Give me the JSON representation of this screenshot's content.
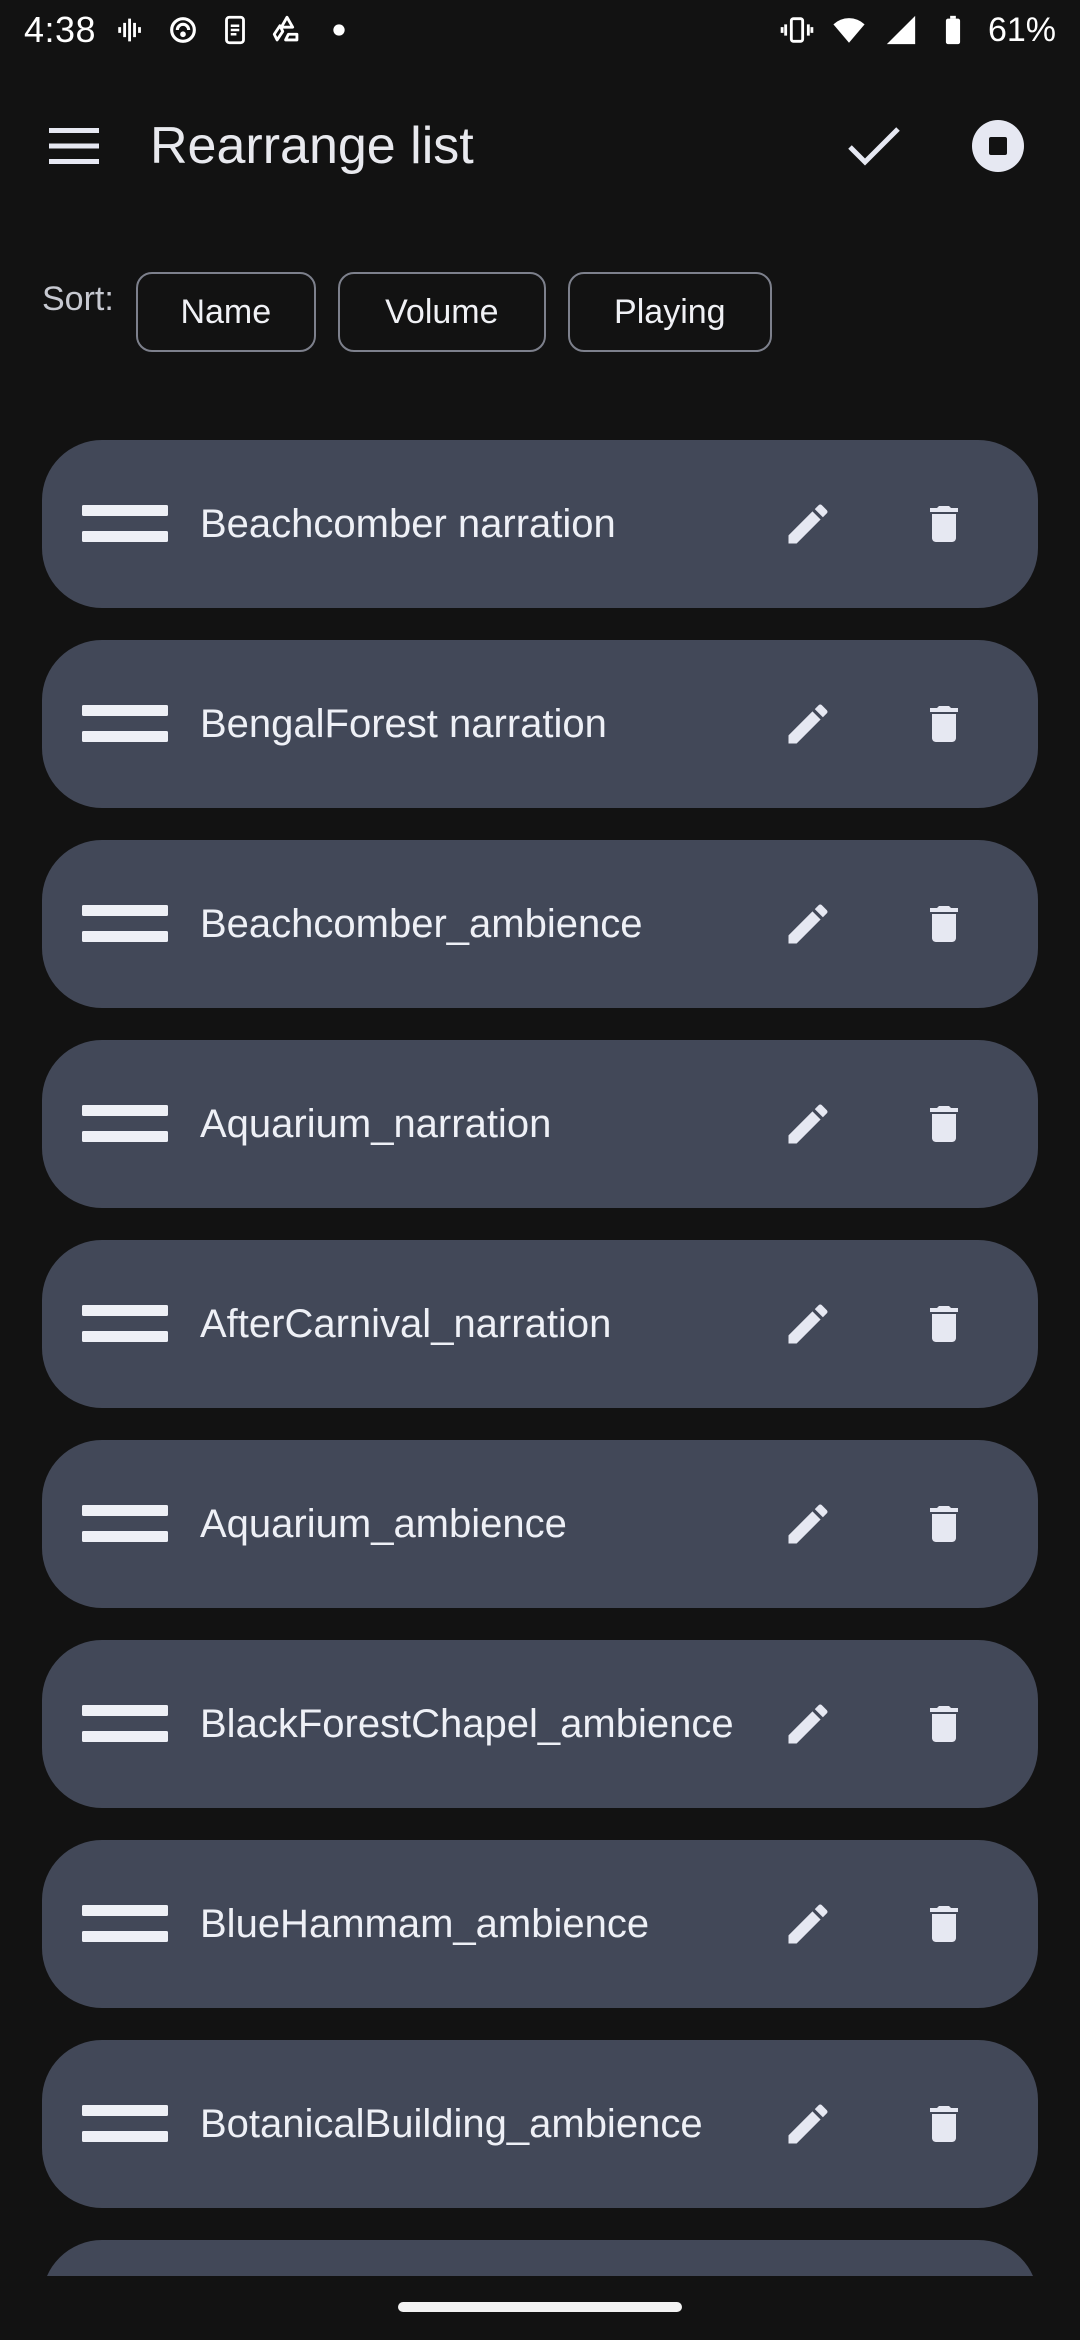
{
  "status_bar": {
    "time": "4:38",
    "battery_percent": "61%",
    "left_icons": [
      "vibrate-waveform-icon",
      "sync-icon",
      "clipboard-icon",
      "recycle-icon",
      "dot-icon"
    ],
    "right_icons": [
      "vibrate-icon",
      "wifi-icon",
      "signal-icon",
      "battery-icon"
    ]
  },
  "app_bar": {
    "title": "Rearrange list",
    "menu_icon": "hamburger-menu-icon",
    "confirm_icon": "check-icon",
    "stop_icon": "stop-circle-icon"
  },
  "sort": {
    "label": "Sort:",
    "options": [
      "Name",
      "Volume",
      "Playing"
    ]
  },
  "list": {
    "items": [
      {
        "label": "Beachcomber narration"
      },
      {
        "label": "BengalForest narration"
      },
      {
        "label": "Beachcomber_ambience"
      },
      {
        "label": "Aquarium_narration"
      },
      {
        "label": "AfterCarnival_narration"
      },
      {
        "label": "Aquarium_ambience"
      },
      {
        "label": "BlackForestChapel_ambience"
      },
      {
        "label": "BlueHammam_ambience"
      },
      {
        "label": "BotanicalBuilding_ambience"
      }
    ]
  },
  "colors": {
    "background": "#121212",
    "item_background": "#424858",
    "chip_border": "#7d808c",
    "text": "#eef0f6",
    "icon": "#e6e8f2"
  }
}
